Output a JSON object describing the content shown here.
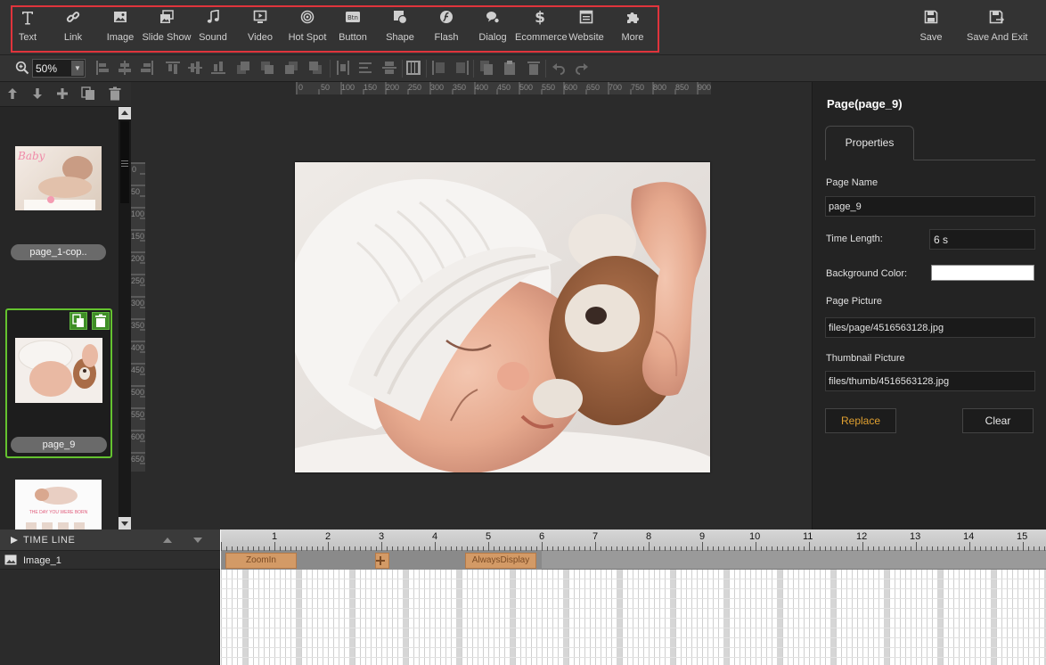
{
  "toolbar": {
    "insert_items": [
      {
        "label": "Text",
        "icon": "text-icon"
      },
      {
        "label": "Link",
        "icon": "link-icon"
      },
      {
        "label": "Image",
        "icon": "image-icon"
      },
      {
        "label": "Slide Show",
        "icon": "slideshow-icon"
      },
      {
        "label": "Sound",
        "icon": "music-note-icon"
      },
      {
        "label": "Video",
        "icon": "video-icon"
      },
      {
        "label": "Hot Spot",
        "icon": "hotspot-icon"
      },
      {
        "label": "Button",
        "icon": "button-icon"
      },
      {
        "label": "Shape",
        "icon": "shape-icon"
      },
      {
        "label": "Flash",
        "icon": "flash-icon"
      },
      {
        "label": "Dialog",
        "icon": "dialog-icon"
      },
      {
        "label": "Ecommerce",
        "icon": "dollar-icon"
      },
      {
        "label": "Website",
        "icon": "website-icon"
      },
      {
        "label": "More",
        "icon": "puzzle-icon"
      }
    ],
    "save_label": "Save",
    "save_exit_label": "Save And Exit",
    "highlight_color": "#e0343c"
  },
  "zoom": {
    "value": "50%"
  },
  "pages": {
    "page1_name": "page_1-cop..",
    "page9_name": "page_9",
    "page3_caption": "THE DAY YOU WERE BORN",
    "page1_overlay": "Baby"
  },
  "ruler": {
    "horizontal": [
      "0",
      "50",
      "100",
      "150",
      "200",
      "250",
      "300",
      "350",
      "400",
      "450",
      "500",
      "550",
      "600",
      "650",
      "700",
      "750",
      "800",
      "850",
      "900"
    ],
    "vertical": [
      "0",
      "50",
      "100",
      "150",
      "200",
      "250",
      "300",
      "350",
      "400",
      "450",
      "500",
      "550",
      "600",
      "650"
    ]
  },
  "properties": {
    "title": "Page(page_9)",
    "tab": "Properties",
    "page_name_label": "Page Name",
    "page_name_value": "page_9",
    "time_length_label": "Time Length:",
    "time_length_value": "6 s",
    "bg_color_label": "Background Color:",
    "bg_color": "#ffffff",
    "page_picture_label": "Page Picture",
    "page_picture_value": "files/page/4516563128.jpg",
    "thumb_picture_label": "Thumbnail Picture",
    "thumb_picture_value": "files/thumb/4516563128.jpg",
    "replace_label": "Replace",
    "clear_label": "Clear",
    "replace_color": "#e0a030"
  },
  "timeline": {
    "title": "TIME LINE",
    "layer_name": "Image_1",
    "seconds": [
      "1",
      "2",
      "3",
      "4",
      "5",
      "6",
      "7",
      "8",
      "9",
      "10",
      "11",
      "12",
      "13",
      "14",
      "15"
    ],
    "effect_in": "ZoomIn",
    "effect_display": "AlwaysDisplay"
  }
}
